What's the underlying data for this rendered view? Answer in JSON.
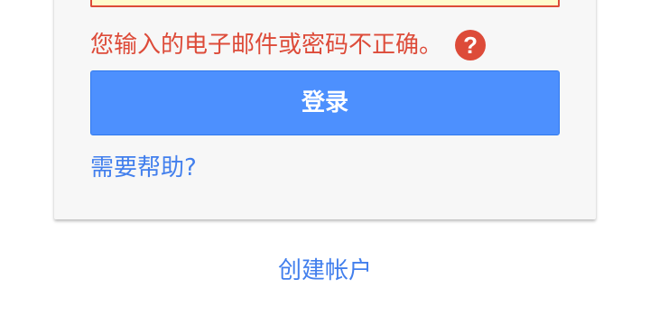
{
  "login_card": {
    "error_message": "您输入的电子邮件或密码不正确。",
    "help_icon_symbol": "?",
    "signin_button_label": "登录",
    "need_help_link": "需要帮助?"
  },
  "footer": {
    "create_account_link": "创建帐户"
  },
  "colors": {
    "error": "#dd4b39",
    "primary_button": "#4d90fe",
    "link": "#427fed",
    "card_background": "#f7f7f7",
    "field_background": "#fffbcc"
  }
}
